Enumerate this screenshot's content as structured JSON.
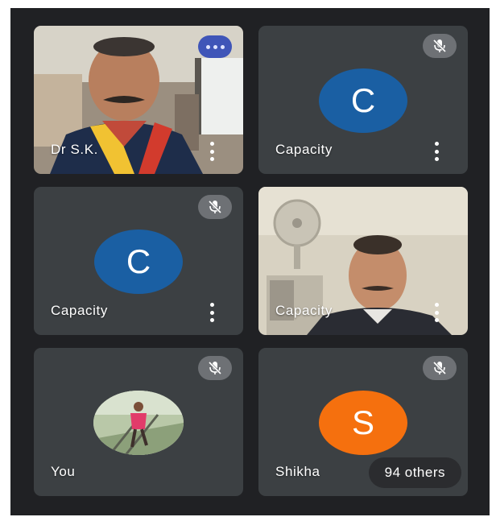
{
  "tiles": [
    {
      "name": "Dr S.K.",
      "type": "video"
    },
    {
      "name": "Capacity",
      "avatar_letter": "C",
      "muted": true
    },
    {
      "name": "Capacity",
      "avatar_letter": "C",
      "muted": true
    },
    {
      "name": "Capacity",
      "type": "video"
    },
    {
      "name": "You",
      "type": "photo",
      "muted": true
    },
    {
      "name": "Shikha",
      "avatar_letter": "S",
      "muted": true,
      "others_label": "94 others"
    }
  ],
  "icons": {
    "more": "more-options-icon",
    "mute": "mic-off-icon",
    "kebab": "kebab-menu-icon"
  },
  "colors": {
    "background": "#202124",
    "tile": "#3c4043",
    "avatar_blue": "#1a5fa3",
    "avatar_orange": "#f5700e",
    "more_button": "#3f55b8"
  }
}
